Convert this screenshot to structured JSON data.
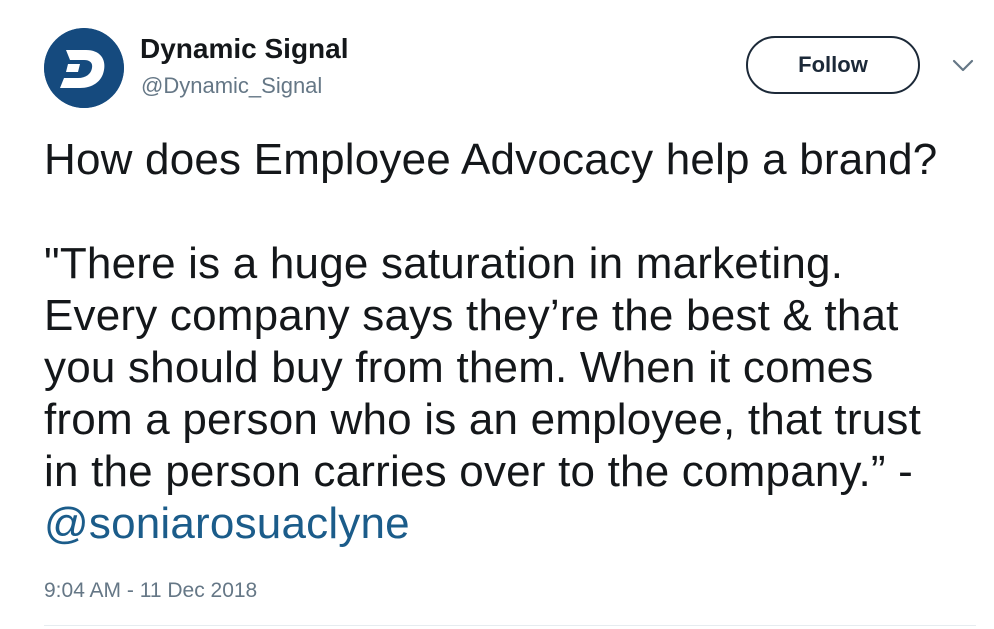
{
  "author": {
    "name": "Dynamic Signal",
    "handle": "@Dynamic_Signal",
    "avatar_icon": "dynamic-signal-logo",
    "avatar_color": "#154a7e"
  },
  "follow_button": {
    "label": "Follow",
    "border_color": "#1c2938"
  },
  "menu_icon": "chevron-down-icon",
  "tweet": {
    "line1": "How does Employee Advocacy help a brand?",
    "quote_lines": [
      "\"There is a huge saturation in marketing.",
      "Every company says they’re the best & that",
      "you should buy from them. When it comes",
      "from a person who is an employee, that trust",
      "in the person carries over to the company.” -"
    ],
    "mention": "@soniarosuaclyne",
    "mention_color": "#1b5c8a"
  },
  "timestamp": "9:04 AM - 11 Dec 2018"
}
